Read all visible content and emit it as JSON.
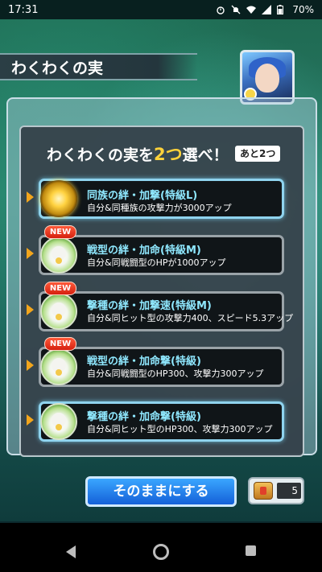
{
  "status_bar": {
    "time": "17:31",
    "battery": "70%",
    "icons": [
      "alarm-icon",
      "notifications-off-icon",
      "wifi-icon",
      "signal-icon",
      "battery-icon"
    ]
  },
  "header": {
    "title": "わくわくの実"
  },
  "panel": {
    "heading_before": "わくわくの実を",
    "heading_num": "2つ",
    "heading_after": "選べ！",
    "remaining": "あと2つ"
  },
  "choices": [
    {
      "new": false,
      "new_label": "",
      "title": "同族の絆・加撃(特級L)",
      "desc": "自分&同種族の攻撃力が3000アップ",
      "icon": "gold-fruit-icon"
    },
    {
      "new": true,
      "new_label": "NEW",
      "title": "戦型の絆・加命(特級M)",
      "desc": "自分&同戦闘型のHPが1000アップ",
      "icon": "lotus-fruit-icon"
    },
    {
      "new": true,
      "new_label": "NEW",
      "title": "撃種の絆・加撃速(特級M)",
      "desc": "自分&同ヒット型の攻撃力400、スピード5.3アップ",
      "icon": "lotus-fruit-icon"
    },
    {
      "new": true,
      "new_label": "NEW",
      "title": "戦型の絆・加命撃(特級)",
      "desc": "自分&同戦闘型のHP300、攻撃力300アップ",
      "icon": "lotus-fruit-icon"
    },
    {
      "new": false,
      "new_label": "",
      "title": "撃種の絆・加命撃(特級)",
      "desc": "自分&同ヒット型のHP300、攻撃力300アップ",
      "icon": "lotus-fruit-icon"
    }
  ],
  "footer": {
    "button_label": "そのままにする",
    "item_count": "5"
  },
  "colors": {
    "accent_gold": "#ffd23a",
    "title_cyan": "#8fe8ff",
    "button_blue": "#1f7ae8"
  }
}
